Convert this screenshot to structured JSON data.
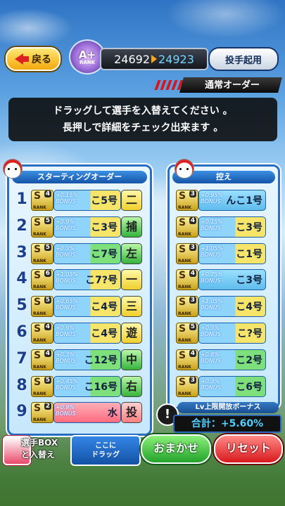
{
  "header": {
    "back_label": "戻る",
    "rank": {
      "grade": "A+",
      "label": "RANK"
    },
    "score_old": "24692",
    "score_new": "24923",
    "pitcher_button": "投手起用"
  },
  "order_mode": "通常オーダー",
  "instruction": {
    "line1": "ドラッグして選手を入替えてください 。",
    "line2": "長押しで詳細をチェック出来ます 。"
  },
  "starting": {
    "title": "スターティングオーダー",
    "rows": [
      {
        "num": "1",
        "grade": "S",
        "level": "4",
        "bonus": "+0.15%",
        "bonus_label": "BONUS",
        "name": "こ5号",
        "position": "二",
        "pos_color": "yellow",
        "plate": "yellowish"
      },
      {
        "num": "2",
        "grade": "S",
        "level": "5",
        "bonus": "+0.9%",
        "bonus_label": "BONUS",
        "name": "こ3号",
        "position": "捕",
        "pos_color": "green",
        "plate": "yellowish"
      },
      {
        "num": "3",
        "grade": "S",
        "level": "5",
        "bonus": "+0.3%",
        "bonus_label": "BONUS",
        "name": "こ7号",
        "position": "左",
        "pos_color": "green",
        "plate": "greenish"
      },
      {
        "num": "4",
        "grade": "S",
        "level": "6",
        "bonus": "+1.05%",
        "bonus_label": "BONUS",
        "name": "こ7?号",
        "position": "一",
        "pos_color": "yellow",
        "plate": "yellowish"
      },
      {
        "num": "5",
        "grade": "S",
        "level": "5",
        "bonus": "+0.65%",
        "bonus_label": "BONUS",
        "name": "こ4号",
        "position": "三",
        "pos_color": "yellow",
        "plate": "yellowish"
      },
      {
        "num": "6",
        "grade": "S",
        "level": "4",
        "bonus": "+0.9%",
        "bonus_label": "BONUS",
        "name": "こ4号",
        "position": "遊",
        "pos_color": "yellow",
        "plate": "yellowish"
      },
      {
        "num": "7",
        "grade": "S",
        "level": "4",
        "bonus": "+0.3%",
        "bonus_label": "BONUS",
        "name": "こ12号",
        "position": "中",
        "pos_color": "green",
        "plate": "greenish"
      },
      {
        "num": "8",
        "grade": "S",
        "level": "5",
        "bonus": "+0.45%",
        "bonus_label": "BONUS",
        "name": "こ16号",
        "position": "右",
        "pos_color": "green",
        "plate": "greenish"
      },
      {
        "num": "9",
        "grade": "S",
        "level": "2",
        "bonus": "+0.9%",
        "bonus_label": "BONUS",
        "name": "水",
        "position": "投",
        "pos_color": "red",
        "plate": "red"
      }
    ]
  },
  "bench": {
    "title": "控え",
    "rows": [
      {
        "grade": "S",
        "level": "3",
        "bonus": "+0.95%",
        "bonus_label": "BONUS",
        "name": "んこ1号",
        "plate": "blue"
      },
      {
        "grade": "S",
        "level": "4",
        "bonus": "+0.15%",
        "bonus_label": "BONUS",
        "name": "こ3号",
        "plate": "yellowish"
      },
      {
        "grade": "S",
        "level": "3",
        "bonus": "+1.05%",
        "bonus_label": "BONUS",
        "name": "こ1号",
        "plate": "yellowish"
      },
      {
        "grade": "S",
        "level": "4",
        "bonus": "+0.75%",
        "bonus_label": "BONUS",
        "name": "こ3号",
        "plate": "blue"
      },
      {
        "grade": "S",
        "level": "3",
        "bonus": "+1.05%",
        "bonus_label": "BONUS",
        "name": "こ4号",
        "plate": "yellowish"
      },
      {
        "grade": "S",
        "level": "5",
        "bonus": "+0.3%",
        "bonus_label": "BONUS",
        "name": "こ?号",
        "plate": "yellowish"
      },
      {
        "grade": "S",
        "level": "4",
        "bonus": "+0.8%",
        "bonus_label": "BONUS",
        "name": "こ2号",
        "plate": "greenish"
      },
      {
        "grade": "S",
        "level": "3",
        "bonus": "+0.3%",
        "bonus_label": "BONUS",
        "name": "こ6号",
        "plate": "greenish"
      }
    ]
  },
  "lv_bonus": {
    "title": "Lv上限開放ボーナス",
    "total": "合計：+5.60%"
  },
  "footer": {
    "box_label_1": "選手BOX",
    "box_label_2": "と入替え",
    "drop_1": "ここに",
    "drop_2": "ドラッグ",
    "omakase": "おまかせ",
    "reset": "リセット"
  }
}
